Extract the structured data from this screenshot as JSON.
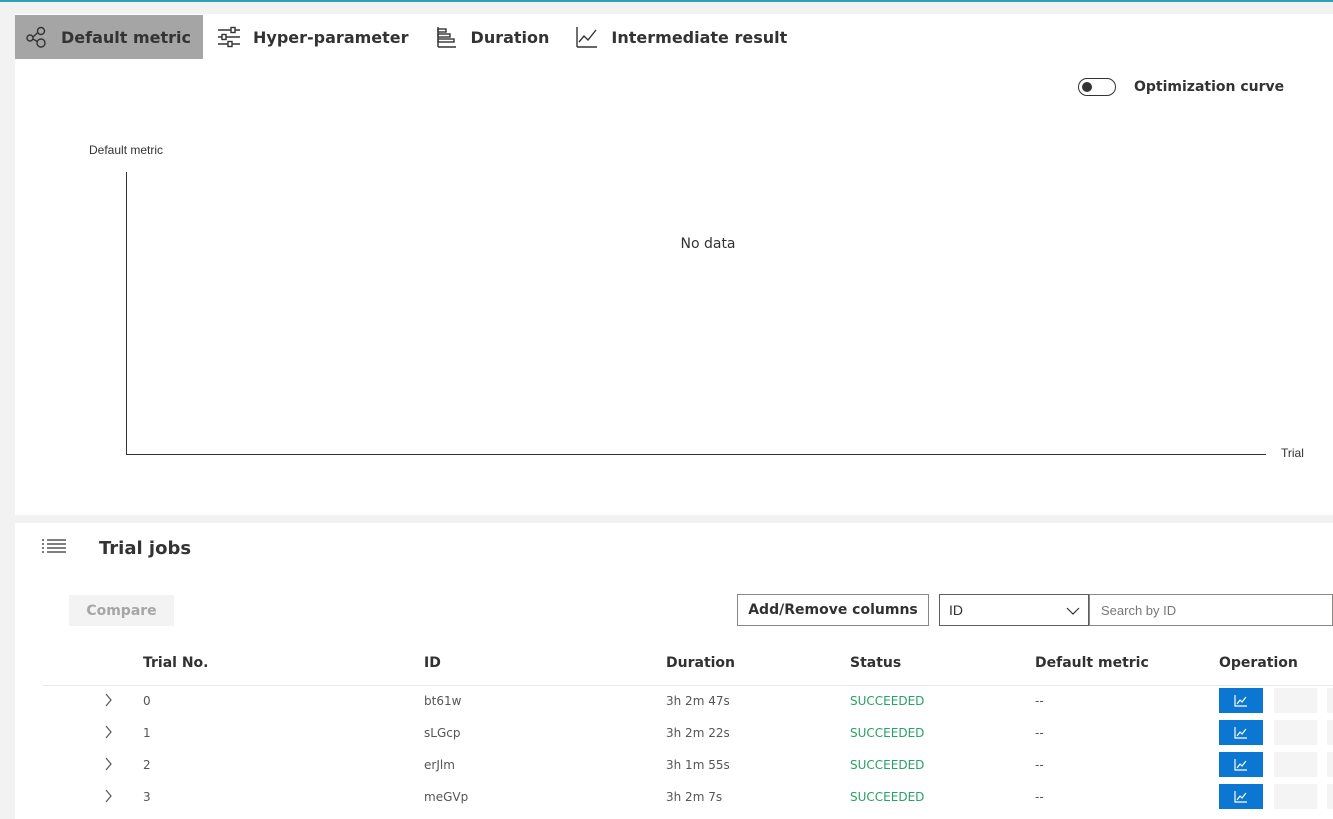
{
  "tabs": [
    {
      "label": "Default metric",
      "icon": "scatter-nodes-icon",
      "active": true
    },
    {
      "label": "Hyper-parameter",
      "icon": "sliders-icon",
      "active": false
    },
    {
      "label": "Duration",
      "icon": "bar-chart-icon",
      "active": false
    },
    {
      "label": "Intermediate result",
      "icon": "line-chart-icon",
      "active": false
    }
  ],
  "optimization_toggle": {
    "label": "Optimization curve",
    "on": false
  },
  "chart": {
    "ylabel": "Default metric",
    "xlabel": "Trial",
    "empty_text": "No data"
  },
  "chart_data": {
    "type": "scatter",
    "xlabel": "Trial",
    "ylabel": "Default metric",
    "x": [],
    "y": [],
    "grid": false
  },
  "trial_jobs": {
    "title": "Trial jobs",
    "compare_label": "Compare",
    "add_remove_label": "Add/Remove columns",
    "search_field_selected": "ID",
    "search_placeholder": "Search by ID",
    "columns": [
      "Trial No.",
      "ID",
      "Duration",
      "Status",
      "Default metric",
      "Operation"
    ],
    "rows": [
      {
        "trial": "0",
        "id": "bt61w",
        "duration": "3h 2m 47s",
        "status": "SUCCEEDED",
        "metric": "--"
      },
      {
        "trial": "1",
        "id": "sLGcp",
        "duration": "3h 2m 22s",
        "status": "SUCCEEDED",
        "metric": "--"
      },
      {
        "trial": "2",
        "id": "erJlm",
        "duration": "3h 1m 55s",
        "status": "SUCCEEDED",
        "metric": "--"
      },
      {
        "trial": "3",
        "id": "meGVp",
        "duration": "3h 2m 7s",
        "status": "SUCCEEDED",
        "metric": "--"
      }
    ]
  },
  "colors": {
    "accent": "#0b77d2",
    "success": "#25a265",
    "active_tab": "#a5a5a5"
  }
}
